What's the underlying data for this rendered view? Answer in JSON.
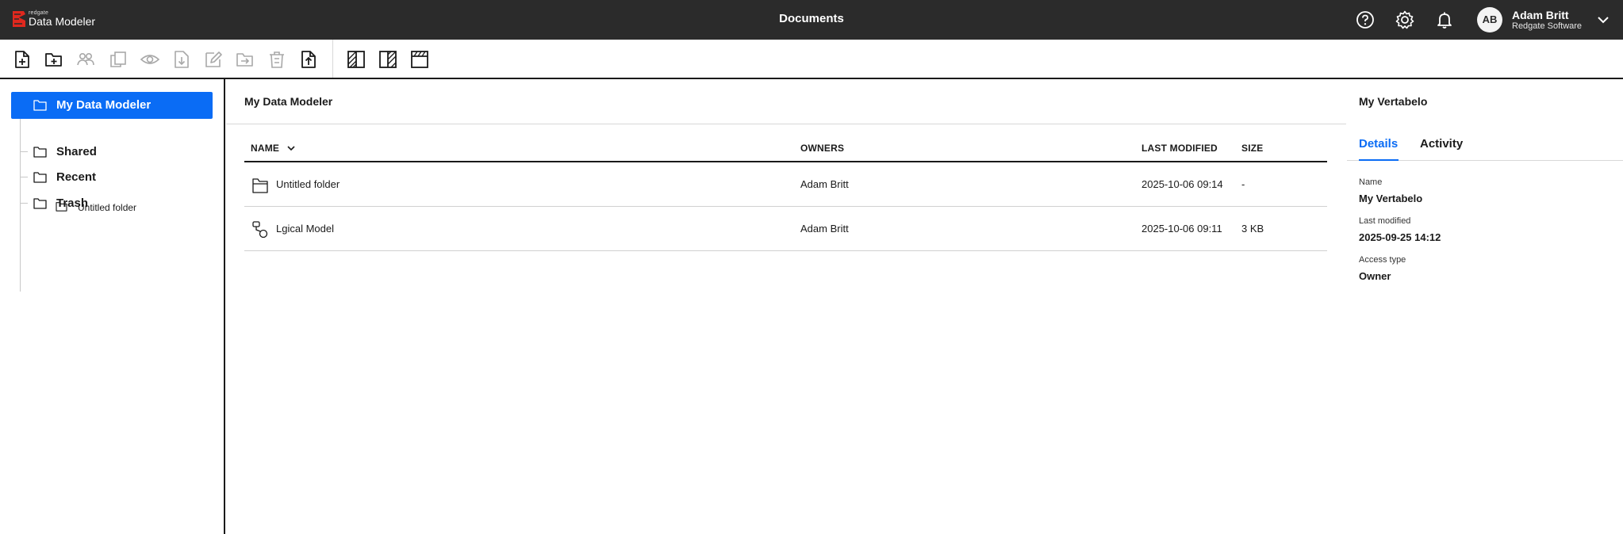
{
  "header": {
    "logo_small": "redgate",
    "logo_big": "Data Modeler",
    "title": "Documents",
    "icons": [
      "help-icon",
      "settings-icon",
      "bell-icon"
    ],
    "user": {
      "initials": "AB",
      "name": "Adam Britt",
      "org": "Redgate Software"
    }
  },
  "toolbar": {
    "buttons": [
      "new-document-icon",
      "new-folder-icon",
      "share-icon",
      "copy-icon",
      "preview-icon",
      "download-icon",
      "rename-icon",
      "move-icon",
      "delete-icon",
      "upload-icon",
      "layout-left-icon",
      "layout-right-icon",
      "layout-top-icon"
    ]
  },
  "tree": {
    "root": "My Data Modeler",
    "child": "Untitled folder",
    "shared": "Shared",
    "recent": "Recent",
    "trash": "Trash"
  },
  "main": {
    "breadcrumb": "My Data Modeler",
    "columns": {
      "name": "NAME",
      "owners": "OWNERS",
      "modified": "LAST MODIFIED",
      "size": "SIZE"
    },
    "rows": [
      {
        "type": "folder",
        "name": "Untitled folder",
        "owner": "Adam Britt",
        "modified": "2025-10-06 09:14",
        "size": "-"
      },
      {
        "type": "logical-model",
        "name": "Lgical Model",
        "owner": "Adam Britt",
        "modified": "2025-10-06 09:11",
        "size": "3 KB"
      }
    ]
  },
  "details": {
    "title": "My Vertabelo",
    "tabs": {
      "details": "Details",
      "activity": "Activity"
    },
    "name_label": "Name",
    "name_value": "My Vertabelo",
    "modified_label": "Last modified",
    "modified_value": "2025-09-25 14:12",
    "access_label": "Access type",
    "access_value": "Owner"
  },
  "colors": {
    "header_bg": "#2b2b2b",
    "accent": "#0a6cf5",
    "logo_red": "#e0281e"
  }
}
